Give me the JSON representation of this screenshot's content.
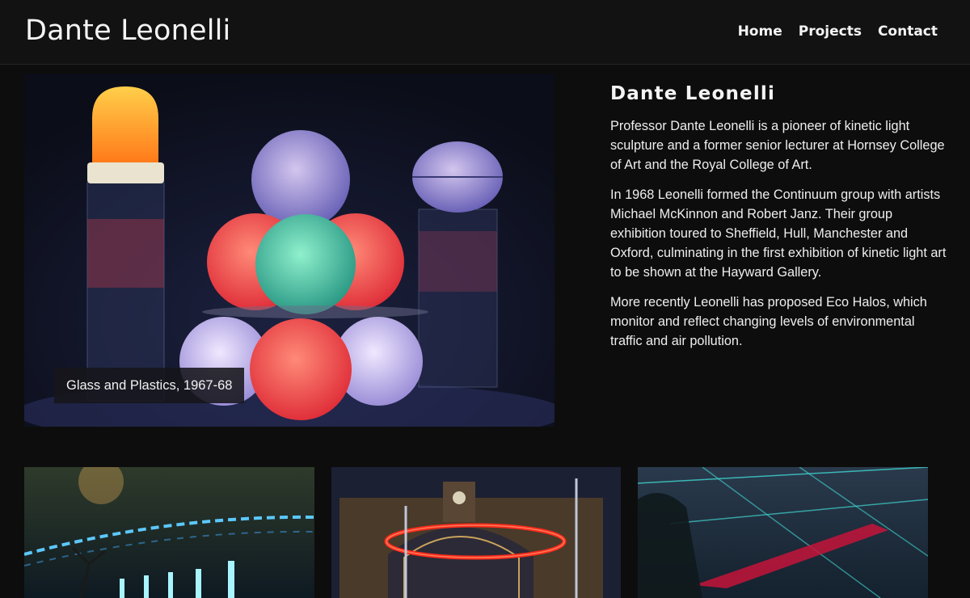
{
  "header": {
    "site_title": "Dante Leonelli",
    "nav": [
      {
        "label": "Home"
      },
      {
        "label": "Projects"
      },
      {
        "label": "Contact"
      }
    ]
  },
  "hero": {
    "caption": "Glass and Plastics, 1967-68"
  },
  "bio": {
    "heading": "Dante Leonelli",
    "paragraphs": [
      "Professor Dante Leonelli is a pioneer of kinetic light sculpture and a former senior lecturer at Hornsey College of Art and the Royal College of Art.",
      "In 1968 Leonelli formed the Continuum group with artists Michael McKinnon and Robert Janz. Their group exhibition toured to Sheffield, Hull, Manchester and Oxford, culminating in the first exhibition of kinetic light art to be shown at the Hayward Gallery.",
      "More recently Leonelli has proposed Eco Halos, which monitor and reflect changing levels of environmental traffic and air pollution."
    ]
  },
  "colors": {
    "page_background": "#0d0d0d",
    "header_background": "#121212",
    "text": "#f4f4f4"
  }
}
